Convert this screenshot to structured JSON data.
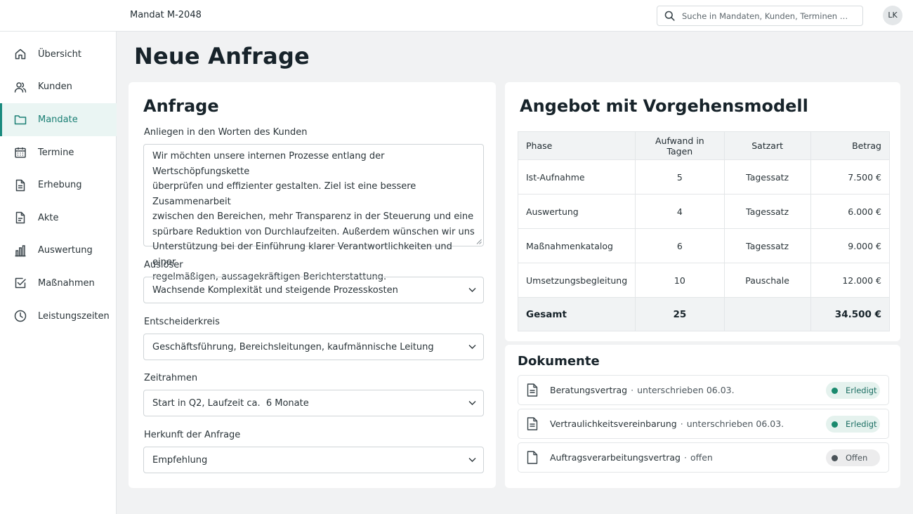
{
  "header": {
    "breadcrumb": "Mandat M-2048",
    "search_placeholder": "Suche in Mandaten, Kunden, Terminen …",
    "avatar_initials": "LK"
  },
  "sidebar": {
    "items": [
      {
        "label": "Übersicht",
        "icon": "home-icon",
        "active": false
      },
      {
        "label": "Kunden",
        "icon": "users-icon",
        "active": false
      },
      {
        "label": "Mandate",
        "icon": "folder-icon",
        "active": true
      },
      {
        "label": "Termine",
        "icon": "calendar-icon",
        "active": false
      },
      {
        "label": "Erhebung",
        "icon": "document-icon",
        "active": false
      },
      {
        "label": "Akte",
        "icon": "file-icon",
        "active": false
      },
      {
        "label": "Auswertung",
        "icon": "bar-chart-icon",
        "active": false
      },
      {
        "label": "Maßnahmen",
        "icon": "checkbox-icon",
        "active": false
      },
      {
        "label": "Leistungszeiten",
        "icon": "clock-icon",
        "active": false
      }
    ],
    "accent": "#1a8a7e"
  },
  "page": {
    "title": "Neue Anfrage"
  },
  "form": {
    "title": "Anfrage",
    "concern_label": "Anliegen in den Worten des Kunden",
    "concern_lines": [
      "Wir möchten unsere internen Prozesse entlang der Wertschöpfungskette",
      "überprüfen und effizienter gestalten. Ziel ist eine bessere Zusammenarbeit",
      "zwischen den Bereichen, mehr Transparenz in der Steuerung und eine",
      "spürbare Reduktion von Durchlaufzeiten. Außerdem wünschen wir uns",
      "Unterstützung bei der Einführung klarer Verantwortlichkeiten und einer",
      "regelmäßigen, aussagekräftigen Berichterstattung."
    ],
    "trigger_label": "Auslöser",
    "trigger_value": "Wachsende Komplexität und steigende Prozesskosten",
    "deciders_label": "Entscheiderkreis",
    "deciders_value": "Geschäftsführung, Bereichsleitungen, kaufmännische Leitung",
    "timeframe_label": "Zeitrahmen",
    "timeframe_value": "Start in Q2, Laufzeit ca.  6 Monate",
    "origin_label": "Herkunft der Anfrage",
    "origin_value": "Empfehlung"
  },
  "offer": {
    "title": "Angebot mit Vorgehensmodell",
    "columns": [
      "Phase",
      "Aufwand in Tagen",
      "Satzart",
      "Betrag"
    ],
    "rows": [
      [
        "Ist-Aufnahme",
        "5",
        "Tagessatz",
        "7.500 €"
      ],
      [
        "Auswertung",
        "4",
        "Tagessatz",
        "6.000 €"
      ],
      [
        "Maßnahmenkatalog",
        "6",
        "Tagessatz",
        "9.000 €"
      ],
      [
        "Umsetzungsbegleitung",
        "10",
        "Pauschale",
        "12.000 €"
      ]
    ],
    "total": [
      "Gesamt",
      "25",
      "",
      "34.500 €"
    ]
  },
  "documents": {
    "title": "Dokumente",
    "items": [
      {
        "name": "Beratungsvertrag",
        "detail": "unterschrieben 06.03.",
        "status": "Erledigt",
        "state": "done"
      },
      {
        "name": "Vertraulichkeitsvereinbarung",
        "detail": "unterschrieben 06.03.",
        "status": "Erledigt",
        "state": "done"
      },
      {
        "name": "Auftragsverarbeitungsvertrag",
        "detail": "offen",
        "status": "Offen",
        "state": "open"
      }
    ],
    "separator": "·"
  }
}
